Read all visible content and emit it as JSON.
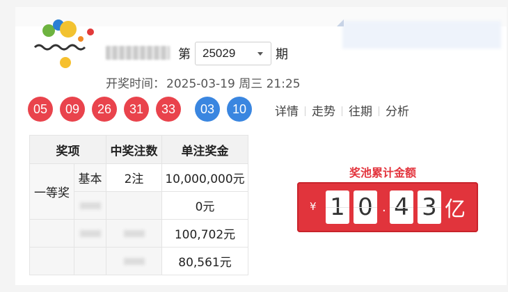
{
  "header": {
    "lottery_name": "",
    "issue_prefix": "第",
    "issue_number": "25029",
    "issue_suffix": "期",
    "draw_time_label": "开奖时间：",
    "draw_time_value": "2025-03-19 周三  21:25"
  },
  "balls": {
    "red": [
      "05",
      "09",
      "26",
      "31",
      "33"
    ],
    "blue": [
      "03",
      "10"
    ],
    "red_color": "#e9434c",
    "blue_color": "#3a86e0"
  },
  "links": [
    "详情",
    "走势",
    "往期",
    "分析"
  ],
  "prize_table": {
    "headers": [
      "奖项",
      "中奖注数",
      "单注奖金"
    ],
    "level_1": "一等奖",
    "rows": [
      {
        "sub": "基本",
        "count": "2注",
        "amount": "10,000,000元"
      },
      {
        "sub": "",
        "count": "",
        "amount": "0元"
      },
      {
        "sub": "",
        "count": "",
        "amount": "100,702元"
      },
      {
        "sub": "",
        "count": "",
        "amount": "80,561元"
      }
    ]
  },
  "pool": {
    "title": "奖池累计金额",
    "currency": "¥",
    "digits": [
      "1",
      "0",
      "4",
      "3"
    ],
    "decimal": ".",
    "unit": "亿",
    "color": "#e1343c"
  }
}
